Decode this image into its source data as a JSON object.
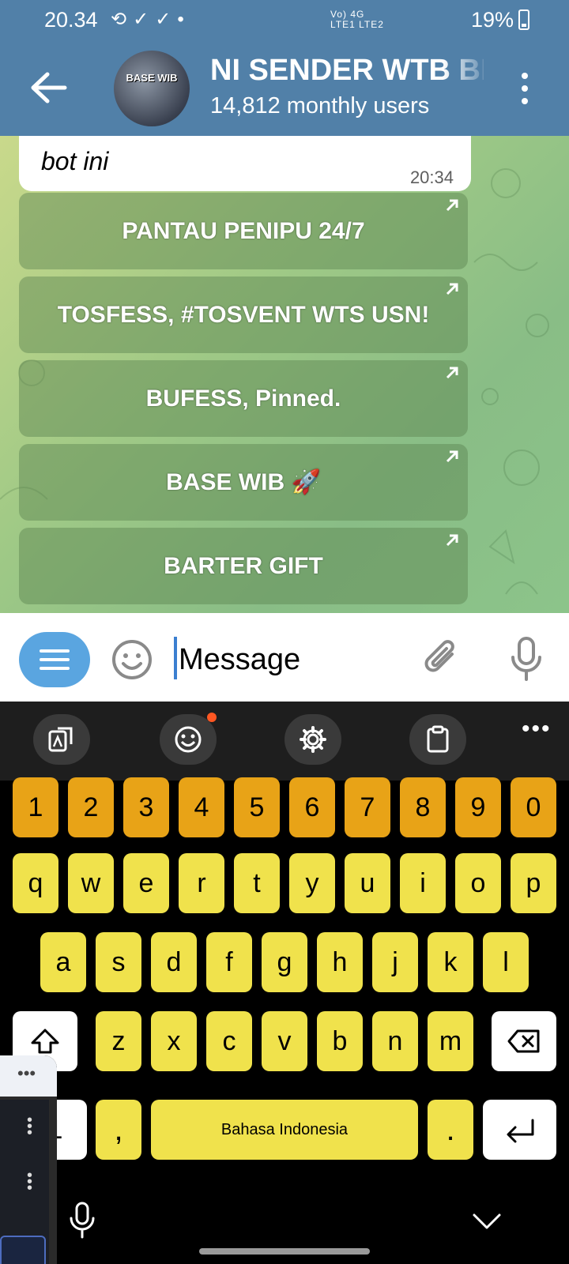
{
  "status_bar": {
    "time": "20.34",
    "battery": "19%",
    "net_line1": "Vo) 4G",
    "net_line2": "LTE1 LTE2"
  },
  "header": {
    "title": "NI SENDER WTB BI",
    "subtitle": "14,812 monthly users",
    "avatar_text": "BASE WIB"
  },
  "message": {
    "text": "bot ini",
    "time": "20:34"
  },
  "inline_buttons": [
    {
      "label": "PANTAU PENIPU 24/7"
    },
    {
      "label": "TOSFESS, #TOSVENT WTS USN!"
    },
    {
      "label": "BUFESS, Pinned."
    },
    {
      "label": "BASE WIB 🚀"
    },
    {
      "label": "BARTER GIFT"
    }
  ],
  "input": {
    "placeholder": "Message"
  },
  "keyboard": {
    "numbers": [
      "1",
      "2",
      "3",
      "4",
      "5",
      "6",
      "7",
      "8",
      "9",
      "0"
    ],
    "row1": [
      "q",
      "w",
      "e",
      "r",
      "t",
      "y",
      "u",
      "i",
      "o",
      "p"
    ],
    "row2": [
      "a",
      "s",
      "d",
      "f",
      "g",
      "h",
      "j",
      "k",
      "l"
    ],
    "row3": [
      "z",
      "x",
      "c",
      "v",
      "b",
      "n",
      "m"
    ],
    "symbols_key": "1",
    "comma": ",",
    "space_label": "Bahasa Indonesia",
    "period": "."
  },
  "colors": {
    "header": "#5180a8",
    "number_keys": "#e8a317",
    "letter_keys": "#f0e24c",
    "bot_menu": "#5aa5e0"
  }
}
